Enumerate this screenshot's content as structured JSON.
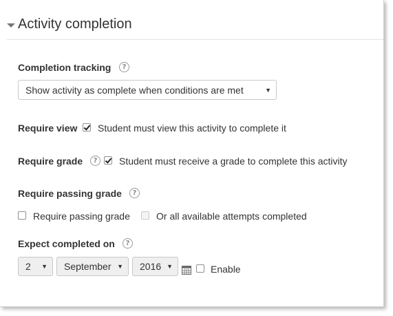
{
  "section": {
    "title": "Activity completion"
  },
  "completion_tracking": {
    "label": "Completion tracking",
    "selected": "Show activity as complete when conditions are met"
  },
  "require_view": {
    "label": "Require view",
    "checked": true,
    "description": "Student must view this activity to complete it"
  },
  "require_grade": {
    "label": "Require grade",
    "checked": true,
    "description": "Student must receive a grade to complete this activity"
  },
  "require_passing_grade": {
    "label": "Require passing grade",
    "option1": {
      "label": "Require passing grade",
      "checked": false
    },
    "option2": {
      "label": "Or all available attempts completed",
      "checked": false,
      "disabled": true
    }
  },
  "expect_completed": {
    "label": "Expect completed on",
    "day": "2",
    "month": "September",
    "year": "2016",
    "enable_label": "Enable",
    "enable_checked": false
  },
  "icons": {
    "help": "help-circle-icon",
    "caret": "caret-down-icon",
    "calendar": "calendar-icon",
    "dropdown": "dropdown-arrow-icon"
  }
}
